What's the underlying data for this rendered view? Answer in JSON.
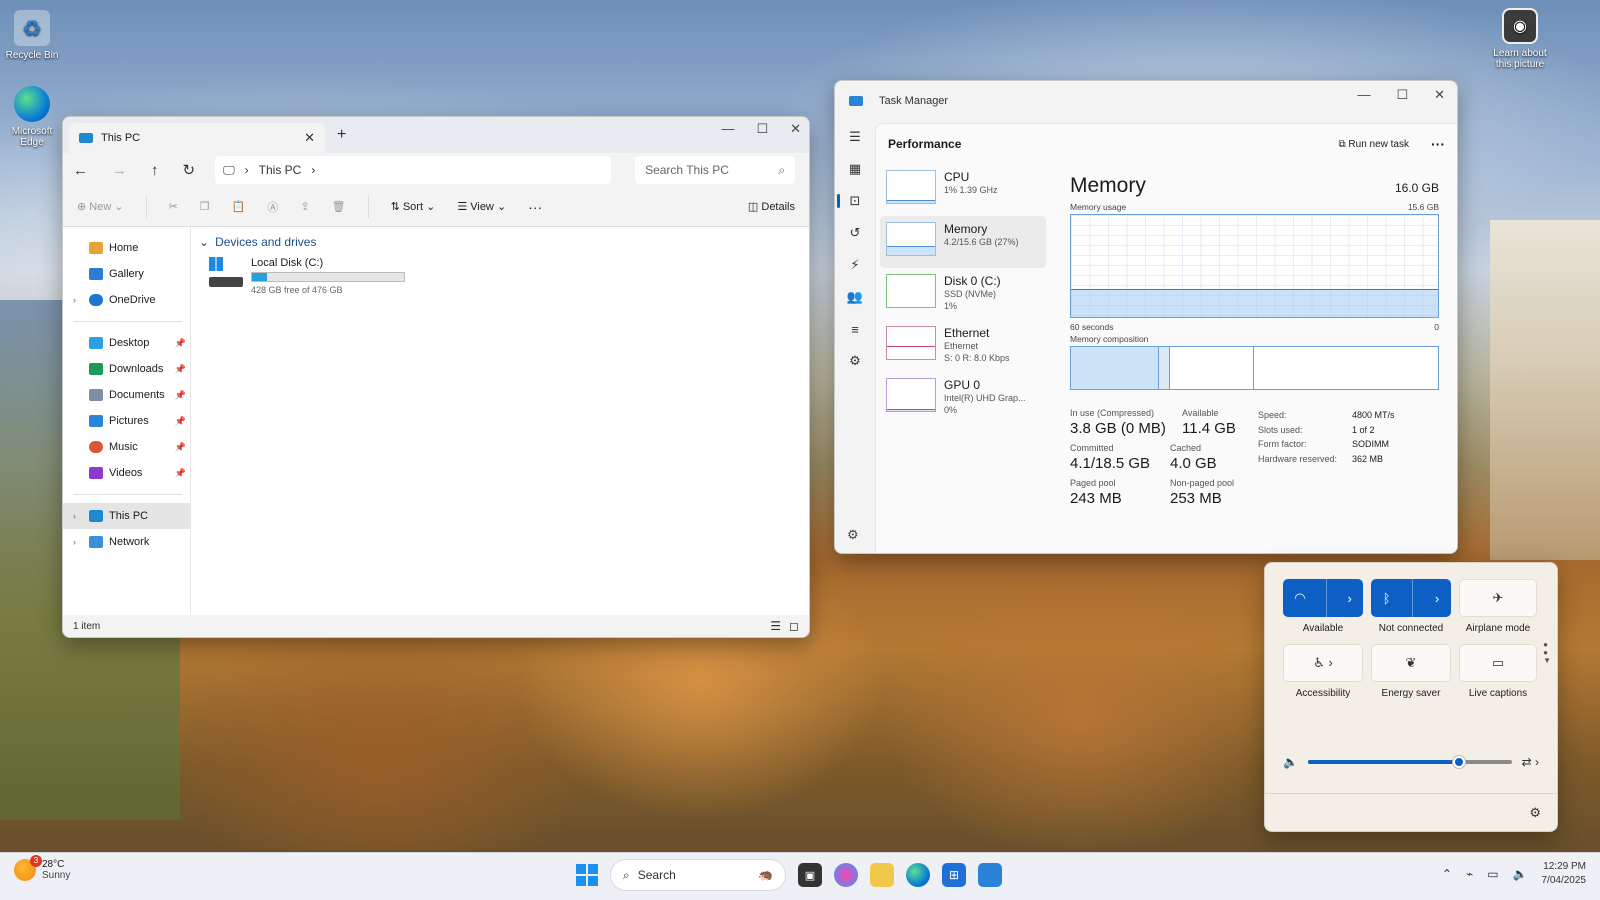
{
  "desktop": {
    "icons": [
      {
        "label": "Recycle Bin"
      },
      {
        "label": "Microsoft Edge"
      },
      {
        "label": "Learn about this picture"
      }
    ]
  },
  "explorer": {
    "tab_title": "This PC",
    "breadcrumb": "This PC",
    "search_placeholder": "Search This PC",
    "toolbar": {
      "new": "New",
      "sort": "Sort",
      "view": "View",
      "details": "Details"
    },
    "nav": {
      "home": "Home",
      "gallery": "Gallery",
      "onedrive": "OneDrive",
      "desktop": "Desktop",
      "downloads": "Downloads",
      "documents": "Documents",
      "pictures": "Pictures",
      "music": "Music",
      "videos": "Videos",
      "thispc": "This PC",
      "network": "Network"
    },
    "group_title": "Devices and drives",
    "drive": {
      "name": "Local Disk (C:)",
      "free_text": "428 GB free of 476 GB",
      "used_fraction": 0.1
    },
    "status": "1 item"
  },
  "taskmgr": {
    "title": "Task Manager",
    "section": "Performance",
    "run_new_task": "Run new task",
    "list": [
      {
        "name": "CPU",
        "line1": "1% 1.39 GHz",
        "line2": ""
      },
      {
        "name": "Memory",
        "line1": "4.2/15.6 GB (27%)",
        "line2": ""
      },
      {
        "name": "Disk 0 (C:)",
        "line1": "SSD (NVMe)",
        "line2": "1%"
      },
      {
        "name": "Ethernet",
        "line1": "Ethernet",
        "line2": "S: 0 R: 8.0 Kbps"
      },
      {
        "name": "GPU 0",
        "line1": "Intel(R) UHD Grap...",
        "line2": "0%"
      }
    ],
    "detail": {
      "title": "Memory",
      "total": "16.0 GB",
      "usage_label": "Memory usage",
      "usage_max": "15.6 GB",
      "time_label": "60 seconds",
      "time_end": "0",
      "composition_label": "Memory composition",
      "in_use_label": "In use (Compressed)",
      "in_use": "3.8 GB (0 MB)",
      "available_label": "Available",
      "available": "11.4 GB",
      "committed_label": "Committed",
      "committed": "4.1/18.5 GB",
      "cached_label": "Cached",
      "cached": "4.0 GB",
      "paged_label": "Paged pool",
      "paged": "243 MB",
      "nonpaged_label": "Non-paged pool",
      "nonpaged": "253 MB",
      "speed_label": "Speed:",
      "speed": "4800 MT/s",
      "slots_label": "Slots used:",
      "slots": "1 of 2",
      "form_label": "Form factor:",
      "form": "SODIMM",
      "reserved_label": "Hardware reserved:",
      "reserved": "362 MB"
    }
  },
  "quick": {
    "wifi": "Available",
    "bluetooth": "Not connected",
    "airplane": "Airplane mode",
    "accessibility": "Accessibility",
    "energy": "Energy saver",
    "captions": "Live captions",
    "volume_fraction": 0.74
  },
  "taskbar": {
    "weather_temp": "28°C",
    "weather_desc": "Sunny",
    "badge": "3",
    "search": "Search",
    "time": "12:29 PM",
    "date": "7/04/2025"
  },
  "colors": {
    "accent": "#0d5fc4",
    "explorer_blue": "#26a0da"
  }
}
